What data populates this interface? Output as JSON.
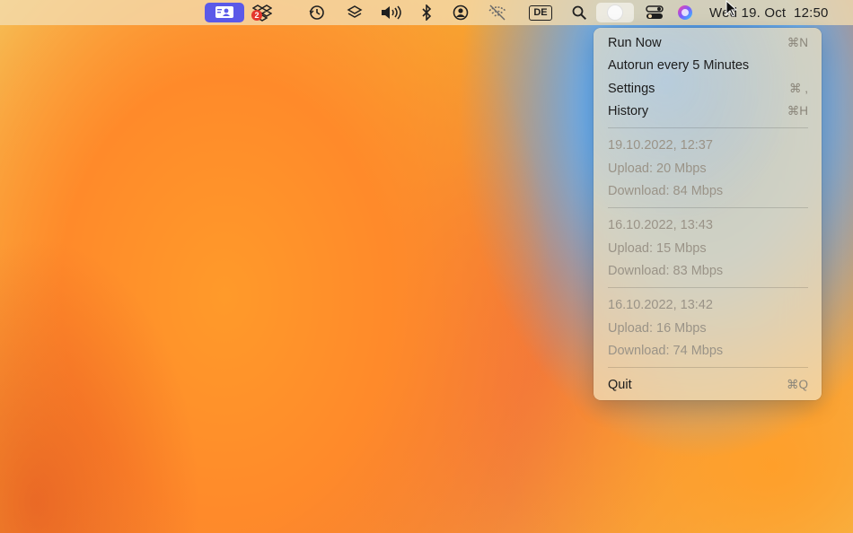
{
  "menubar": {
    "de_label": "DE",
    "clock": "Wed 19. Oct  12:50",
    "icons": [
      "user-card-icon",
      "dropbox-icon",
      "time-machine-icon",
      "shortcuts-icon",
      "volume-icon",
      "bluetooth-icon",
      "user-account-icon",
      "wifi-off-icon",
      "keyboard-input-de",
      "search-icon",
      "speed-test-app-icon",
      "control-center-icon",
      "siri-icon"
    ],
    "badge": "2"
  },
  "menu": {
    "run_now": {
      "label": "Run Now",
      "shortcut": "⌘N"
    },
    "autorun": {
      "label": "Autorun every 5 Minutes"
    },
    "settings": {
      "label": "Settings",
      "shortcut": "⌘ ,"
    },
    "history": {
      "label": "History",
      "shortcut": "⌘H"
    },
    "entries": [
      {
        "date": "19.10.2022, 12:37",
        "upload": "Upload: 20 Mbps",
        "download": "Download: 84 Mbps"
      },
      {
        "date": "16.10.2022, 13:43",
        "upload": "Upload: 15 Mbps",
        "download": "Download: 83 Mbps"
      },
      {
        "date": "16.10.2022, 13:42",
        "upload": "Upload: 16 Mbps",
        "download": "Download: 74 Mbps"
      }
    ],
    "quit": {
      "label": "Quit",
      "shortcut": "⌘Q"
    }
  }
}
